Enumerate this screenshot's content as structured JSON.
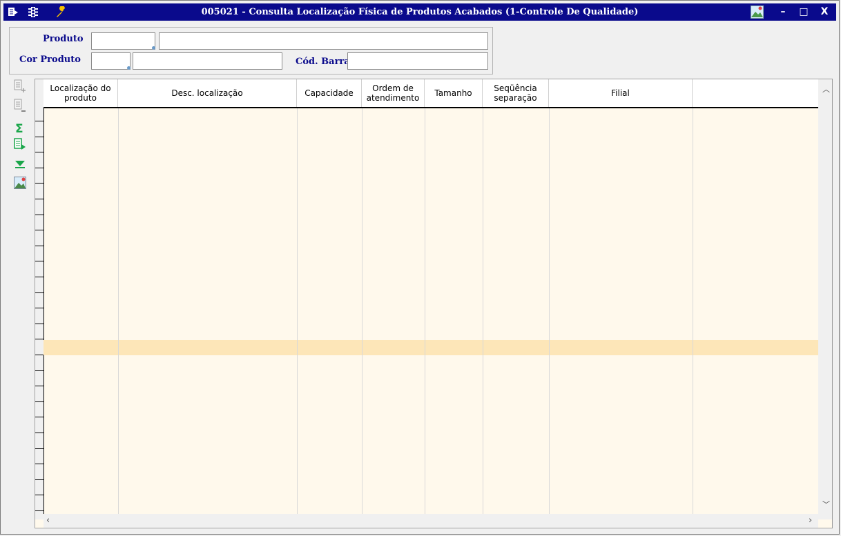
{
  "window": {
    "title": "005021 - Consulta Localização Física de Produtos Acabados (1-Controle De Qualidade)",
    "minimize_label": "–",
    "maximize_label": "□",
    "close_label": "X"
  },
  "filters": {
    "produto_label": "Produto",
    "produto_code": "",
    "produto_desc": "",
    "cor_label": "Cor Produto",
    "cor_code": "",
    "cor_desc": "",
    "barcode_label": "Cód. Barra",
    "barcode_value": ""
  },
  "grid": {
    "columns": [
      {
        "line1": "Localização do",
        "line2": "produto"
      },
      {
        "line1": "Desc. localização",
        "line2": ""
      },
      {
        "line1": "Capacidade",
        "line2": ""
      },
      {
        "line1": "Ordem de",
        "line2": "atendimento"
      },
      {
        "line1": "Tamanho",
        "line2": ""
      },
      {
        "line1": "Seqüência",
        "line2": "separação"
      },
      {
        "line1": "Filial",
        "line2": ""
      }
    ],
    "rows": []
  },
  "colors": {
    "title_bar": "#0a0a8c",
    "label_text": "#0a0a8c",
    "grid_background": "#fff9ec",
    "selected_row": "#fde6b8"
  }
}
